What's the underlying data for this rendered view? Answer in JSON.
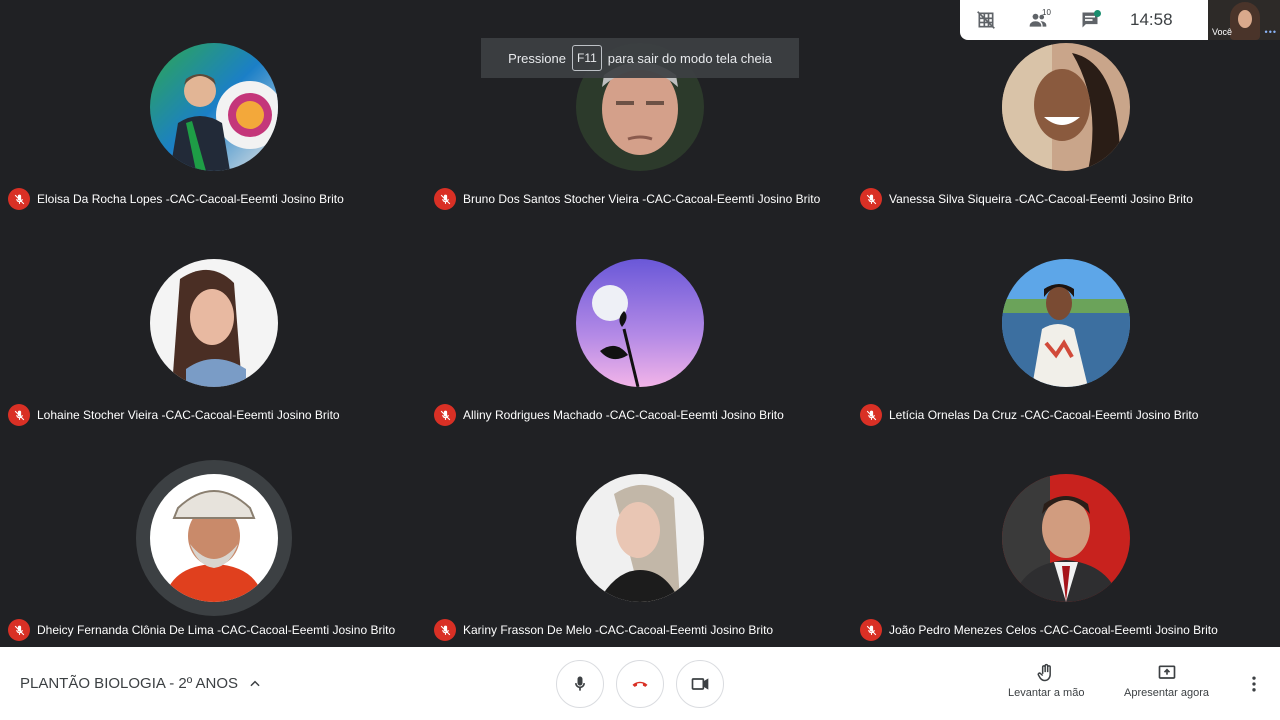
{
  "topbar": {
    "participants_count": "10",
    "time": "14:58",
    "self_label": "Você"
  },
  "toast": {
    "prefix": "Pressione",
    "key": "F11",
    "suffix": "para sair do modo tela cheia"
  },
  "participants": [
    {
      "name": "Eloisa Da Rocha Lopes -CAC-Cacoal-Eeemti Josino Brito"
    },
    {
      "name": "Bruno Dos Santos Stocher Vieira -CAC-Cacoal-Eeemti Josino Brito"
    },
    {
      "name": "Vanessa Silva Siqueira -CAC-Cacoal-Eeemti Josino Brito"
    },
    {
      "name": "Lohaine Stocher Vieira -CAC-Cacoal-Eeemti Josino Brito"
    },
    {
      "name": "Alliny Rodrigues Machado -CAC-Cacoal-Eeemti Josino Brito"
    },
    {
      "name": "Letícia Ornelas Da Cruz -CAC-Cacoal-Eeemti Josino Brito"
    },
    {
      "name": "Dheicy Fernanda Clônia De Lima -CAC-Cacoal-Eeemti Josino Brito"
    },
    {
      "name": "Kariny Frasson De Melo -CAC-Cacoal-Eeemti Josino Brito"
    },
    {
      "name": "João Pedro Menezes Celos -CAC-Cacoal-Eeemti Josino Brito"
    }
  ],
  "bottombar": {
    "meeting_title": "PLANTÃO BIOLOGIA - 2º ANOS",
    "raise_hand_label": "Levantar a mão",
    "present_label": "Apresentar agora"
  },
  "colors": {
    "background": "#202124",
    "muted_badge": "#d93025",
    "hangup": "#d93025"
  }
}
